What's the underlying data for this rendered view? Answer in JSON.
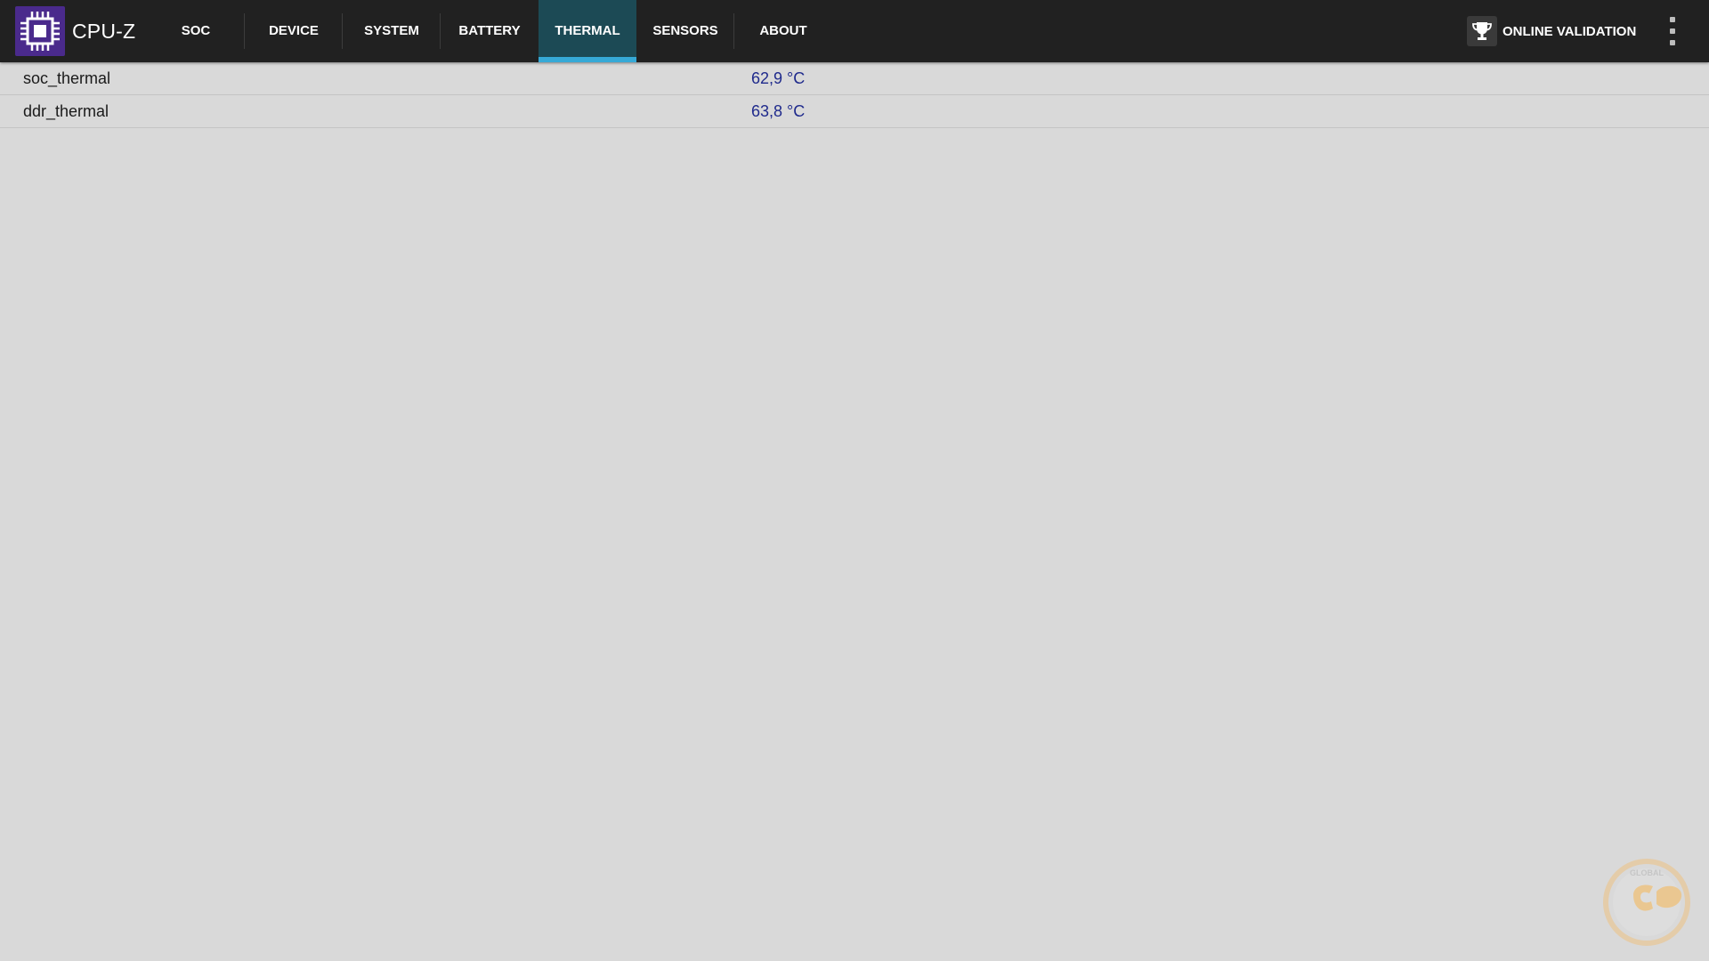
{
  "app": {
    "title": "CPU-Z",
    "logo_icon": "cpu-chip-icon",
    "logo_color": "#4a2a8c"
  },
  "tabs": [
    {
      "label": "SOC",
      "active": false
    },
    {
      "label": "DEVICE",
      "active": false
    },
    {
      "label": "SYSTEM",
      "active": false
    },
    {
      "label": "BATTERY",
      "active": false
    },
    {
      "label": "THERMAL",
      "active": true
    },
    {
      "label": "SENSORS",
      "active": false
    },
    {
      "label": "ABOUT",
      "active": false
    }
  ],
  "header": {
    "validation_label": "ONLINE VALIDATION",
    "validation_icon": "trophy-icon",
    "menu_icon": "overflow-menu-icon"
  },
  "colors": {
    "topbar": "#212121",
    "active_tab": "#1c4a55",
    "active_indicator": "#36a9d6",
    "background": "#d9d9d9",
    "value_text": "#1f2a8c"
  },
  "thermal": {
    "rows": [
      {
        "name": "soc_thermal",
        "value": "62,9 °C"
      },
      {
        "name": "ddr_thermal",
        "value": "63,8 °C"
      }
    ]
  },
  "watermark": {
    "word": "GLOBAL",
    "icon": "gecid-watermark-logo"
  }
}
